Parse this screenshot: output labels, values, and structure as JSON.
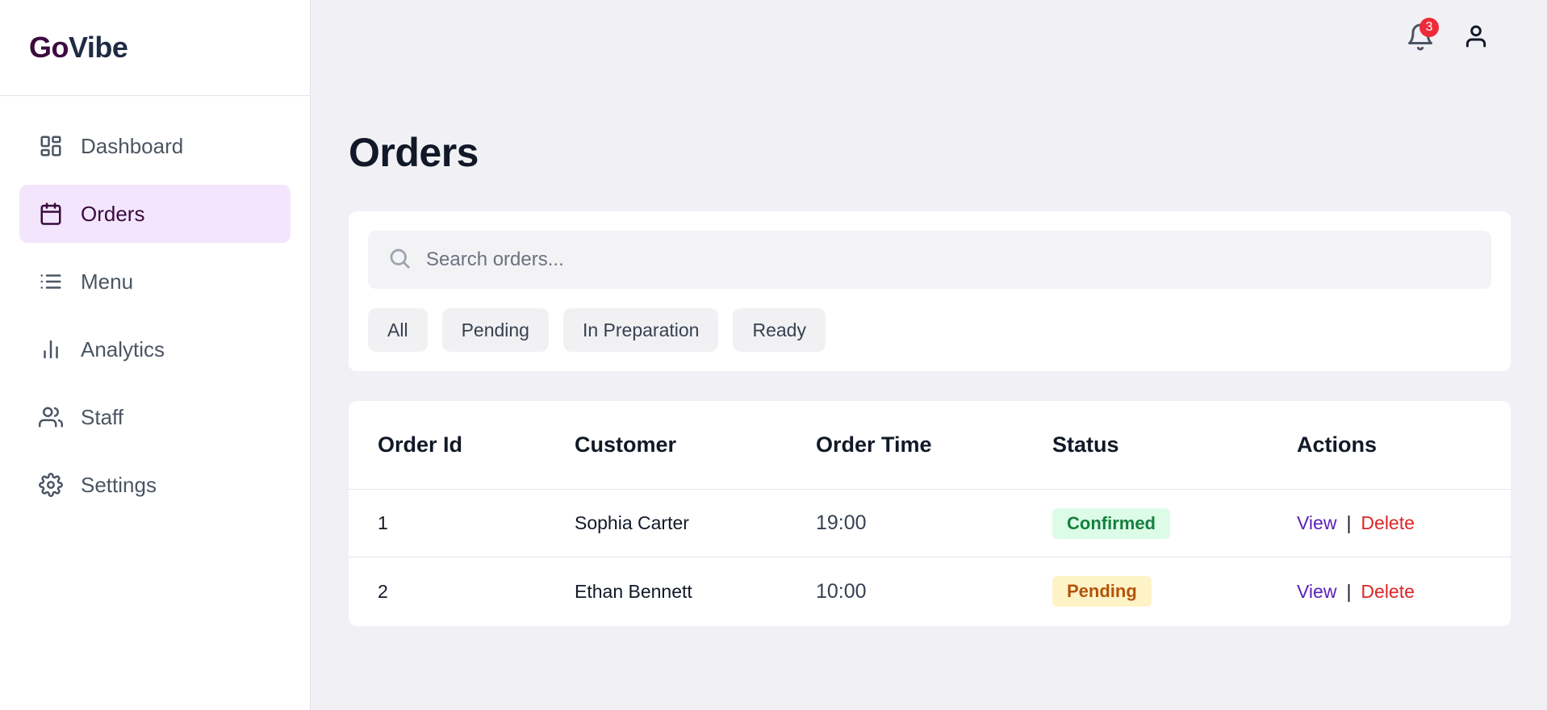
{
  "brand": {
    "part1": "Go",
    "part2": "Vibe"
  },
  "sidebar": {
    "items": [
      {
        "label": "Dashboard",
        "icon": "dashboard-icon"
      },
      {
        "label": "Orders",
        "icon": "calendar-icon",
        "active": true
      },
      {
        "label": "Menu",
        "icon": "list-icon"
      },
      {
        "label": "Analytics",
        "icon": "bar-chart-icon"
      },
      {
        "label": "Staff",
        "icon": "users-icon"
      },
      {
        "label": "Settings",
        "icon": "gear-icon"
      }
    ]
  },
  "header": {
    "notification_count": "3"
  },
  "page": {
    "title": "Orders"
  },
  "search": {
    "placeholder": "Search orders..."
  },
  "filters": [
    "All",
    "Pending",
    "In Preparation",
    "Ready"
  ],
  "table": {
    "headers": {
      "id": "Order Id",
      "customer": "Customer",
      "time": "Order Time",
      "status": "Status",
      "actions": "Actions"
    },
    "rows": [
      {
        "id": "1",
        "customer": "Sophia Carter",
        "time": "19:00",
        "status": "Confirmed",
        "view": "View",
        "sep": "|",
        "delete": "Delete"
      },
      {
        "id": "2",
        "customer": "Ethan Bennett",
        "time": "10:00",
        "status": "Pending",
        "view": "View",
        "sep": "|",
        "delete": "Delete"
      }
    ]
  },
  "colors": {
    "accent": "#3b0a3f",
    "active_bg": "#f3e6fc",
    "confirmed_bg": "#dcfce7",
    "confirmed_text": "#15803d",
    "pending_bg": "#fef3c7",
    "pending_text": "#b45309",
    "view_link": "#5b21b6",
    "delete_link": "#dc2626",
    "badge": "#ef2a3a"
  }
}
